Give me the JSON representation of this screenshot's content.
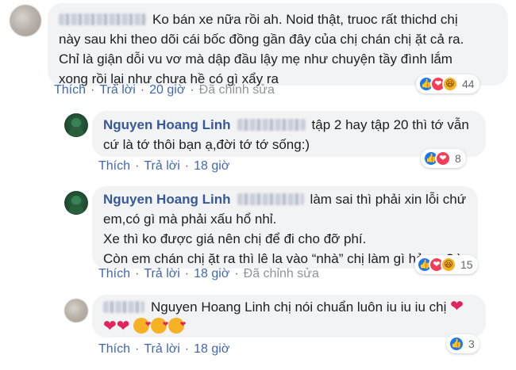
{
  "comments": [
    {
      "id": "c1",
      "author": "",
      "text_lines": [
        "Ko bán xe nữa rồi ah. Noid thật, truoc rất thichd chị",
        "này sau khi theo dõi cái bốc đồng gần đây của chị chán chị ặt cả ra.",
        "Chỉ là giận dỗi vu vơ mà dập đầu lậy mẹ như chuyện tầy đình lắm",
        "xong rồi lại như chưa hề có gì xẩy ra"
      ],
      "actions": {
        "like": "Thích",
        "reply": "Trả lời",
        "time": "20 giờ",
        "edited": "Đã chỉnh sửa"
      },
      "reactions": {
        "types": [
          "like-icon",
          "love-icon",
          "haha-icon"
        ],
        "count": "44"
      }
    },
    {
      "id": "c2",
      "author": "Nguyen Hoang Linh",
      "text_lines": [
        "tập 2 hay tập 20 thì tớ vẫn",
        "cứ là tớ thôi bạn ạ,đời tớ tớ sống:)"
      ],
      "actions": {
        "like": "Thích",
        "reply": "Trả lời",
        "time": "18 giờ"
      },
      "reactions": {
        "types": [
          "like-icon",
          "love-icon"
        ],
        "count": "8"
      }
    },
    {
      "id": "c3",
      "author": "Nguyen Hoang Linh",
      "text_lines": [
        "làm sai thì phải xin lỗi chứ",
        "em,có gì mà phải xấu hổ nhỉ.",
        "Xe thì ko được giá nên chị để đi cho đỡ phí.",
        "Còn em chán chị ặt ra thì lê la vào “nhà” chị làm gì hả em?:)"
      ],
      "actions": {
        "like": "Thích",
        "reply": "Trả lời",
        "time": "18 giờ",
        "edited": "Đã chỉnh sửa"
      },
      "reactions": {
        "types": [
          "like-icon",
          "love-icon",
          "haha-icon"
        ],
        "count": "15"
      }
    },
    {
      "id": "c4",
      "author": "",
      "text_lines": [
        "Nguyen Hoang Linh chị nói chuẩn luôn iu iu iu chị"
      ],
      "actions": {
        "like": "Thích",
        "reply": "Trả lời",
        "time": "18 giờ"
      },
      "reactions": {
        "types": [
          "like-icon"
        ],
        "count": "3"
      }
    }
  ],
  "colors": {
    "link": "#385898",
    "action_link": "#4267b2",
    "bubble": "#f2f3f5",
    "like": "#1877f2",
    "love": "#f33e58",
    "haha": "#f7b125"
  }
}
